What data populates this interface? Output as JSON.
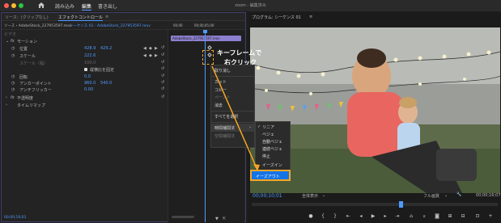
{
  "topbar": {
    "nav": [
      "読み込み",
      "編集",
      "書き出し"
    ],
    "title": "zoom - 編集済み"
  },
  "effect_controls": {
    "source_tab": "ソース：(クリップなし)",
    "active_tab": "エフェクトコントロール",
    "source_clip": "ソース・AdobeStock_227953597.mov",
    "sequence_clip": "シーケンス 01 - AdobeStock_227953597.mov",
    "timeline_start": "00;00",
    "timeline_mark": "00;00;05;00",
    "clip_name": "AdobeStock_227953597.mov",
    "video_header": "ビデオ",
    "motion": "モーション",
    "rows": [
      {
        "label": "位置",
        "v1": "428.9",
        "v2": "429.2"
      },
      {
        "label": "スケール",
        "v1": "222.6",
        "v2": ""
      },
      {
        "label": "スケール（幅）",
        "v1": "100.0",
        "v2": ""
      },
      {
        "label": "縦横比を固定",
        "v1": "",
        "v2": ""
      },
      {
        "label": "回転",
        "v1": "0.0",
        "v2": ""
      },
      {
        "label": "アンカーポイント",
        "v1": "960.0",
        "v2": "540.0"
      },
      {
        "label": "アンチフリッカー",
        "v1": "0.00",
        "v2": ""
      }
    ],
    "opacity": "不透明度",
    "time_remap": "タイムリマップ",
    "bottom_timecode": "00;00;10;01"
  },
  "program": {
    "title": "プログラム: シーケンス 01",
    "timecode": "00;00;10;01",
    "fit": "全体表示",
    "quality": "フル画質",
    "duration": "00;00;16;07"
  },
  "context_menu": {
    "items": [
      "取り消し",
      "カット",
      "コピー",
      "ペースト",
      "消去",
      "すべてを選択",
      "時間補間法",
      "空間補間法"
    ],
    "submenu": [
      "リニア",
      "ベジェ",
      "自動ベジェ",
      "連続ベジェ",
      "停止",
      "イーズイン",
      "イーズアウト"
    ],
    "selected": "リニア",
    "highlighted": "イーズアウト"
  },
  "annotations": {
    "line1": "キーフレームで",
    "line2": "右クリック"
  },
  "colors": {
    "accent_blue": "#4f9bff",
    "highlight_orange": "#f5a623",
    "clip_purple": "#8c7fcf"
  }
}
